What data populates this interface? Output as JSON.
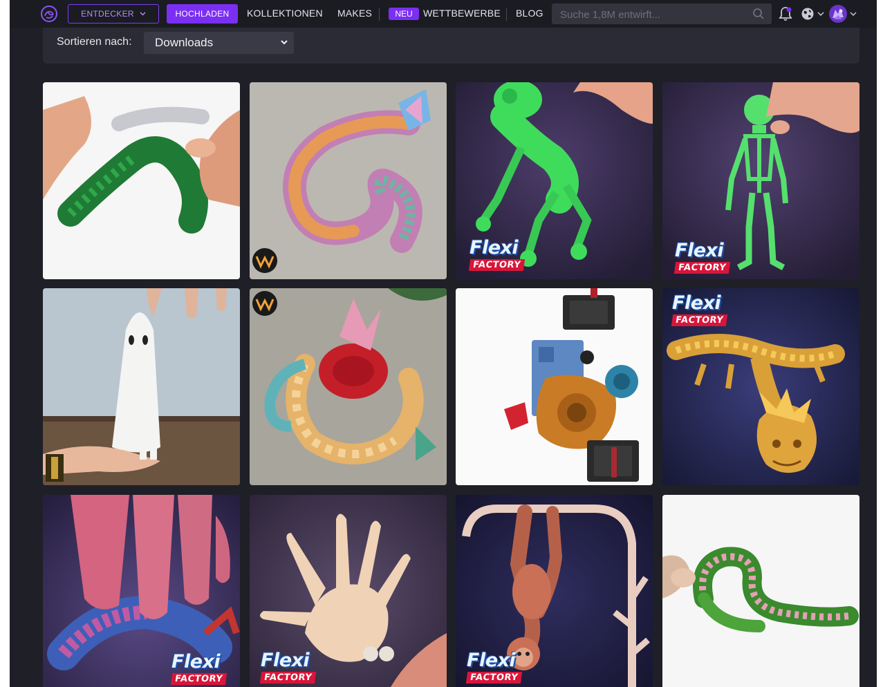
{
  "nav": {
    "explore_label": "ENTDECKER",
    "upload_label": "HOCHLADEN",
    "collections_label": "KOLLEKTIONEN",
    "makes_label": "MAKES",
    "new_badge": "NEU",
    "contests_label": "WETTBEWERBE",
    "blog_label": "BLOG",
    "search_placeholder": "Suche 1,8M entwirft..."
  },
  "sort": {
    "label": "Sortieren nach:",
    "selected": "Downloads"
  },
  "watermark": {
    "word": "Flexi",
    "factory": "FACTORY"
  },
  "colors": {
    "accent": "#7b2ff2",
    "nav_bg": "#1b1b22",
    "page_bg": "#1f1f27",
    "panel_bg": "#2b2b35"
  },
  "cards": [
    {
      "subject": "articulated green dragon held in hands",
      "watermark": "none"
    },
    {
      "subject": "rainbow crystal dragon on concrete",
      "watermark": "badge"
    },
    {
      "subject": "green articulated frog",
      "watermark": "flexi-factory"
    },
    {
      "subject": "green articulated skeleton",
      "watermark": "flexi-factory"
    },
    {
      "subject": "white ghost figure on finger",
      "watermark": "corner-logo"
    },
    {
      "subject": "rose dragon with flowers",
      "watermark": "badge"
    },
    {
      "subject": "exploded view hotend assembly",
      "watermark": "none"
    },
    {
      "subject": "golden articulated dragon",
      "watermark": "flexi-factory"
    },
    {
      "subject": "blue-pink articulated lizard",
      "watermark": "flexi-factory"
    },
    {
      "subject": "articulated hand",
      "watermark": "flexi-factory"
    },
    {
      "subject": "articulated hanging monkey",
      "watermark": "flexi-factory"
    },
    {
      "subject": "green-pink articulated snake",
      "watermark": "none"
    }
  ]
}
